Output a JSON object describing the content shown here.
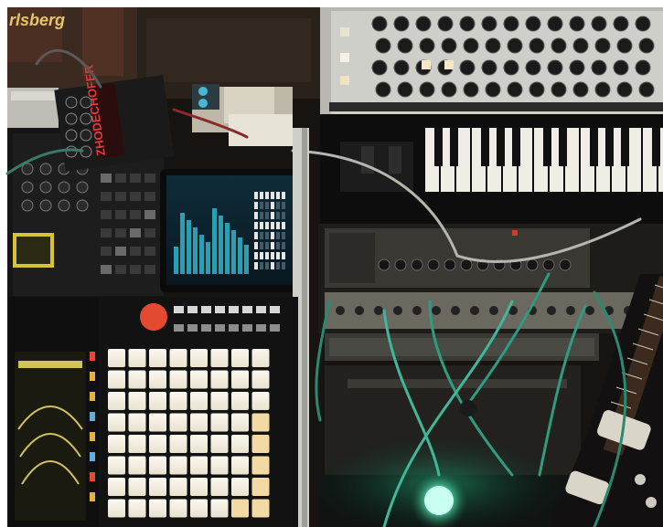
{
  "photo": {
    "sign_text": "rlsberg",
    "pedal_text": "ZHODECHOFER"
  },
  "colors": {
    "frame": "#ffffff",
    "background": "#1a1614",
    "wall_brown": "#3a2a20",
    "synth_panel": "#cfcfc9",
    "knob": "#1b1b1b",
    "screen_cyan": "#2fb6c9",
    "pad_light": "#f2ede0",
    "pad_warm": "#f3d9a3",
    "green_light": "#27c98a",
    "cable_green": "#3fb79a",
    "rack_grey": "#4a4a45"
  },
  "icons": [
    "guitar-icon",
    "light-bulb-icon"
  ]
}
